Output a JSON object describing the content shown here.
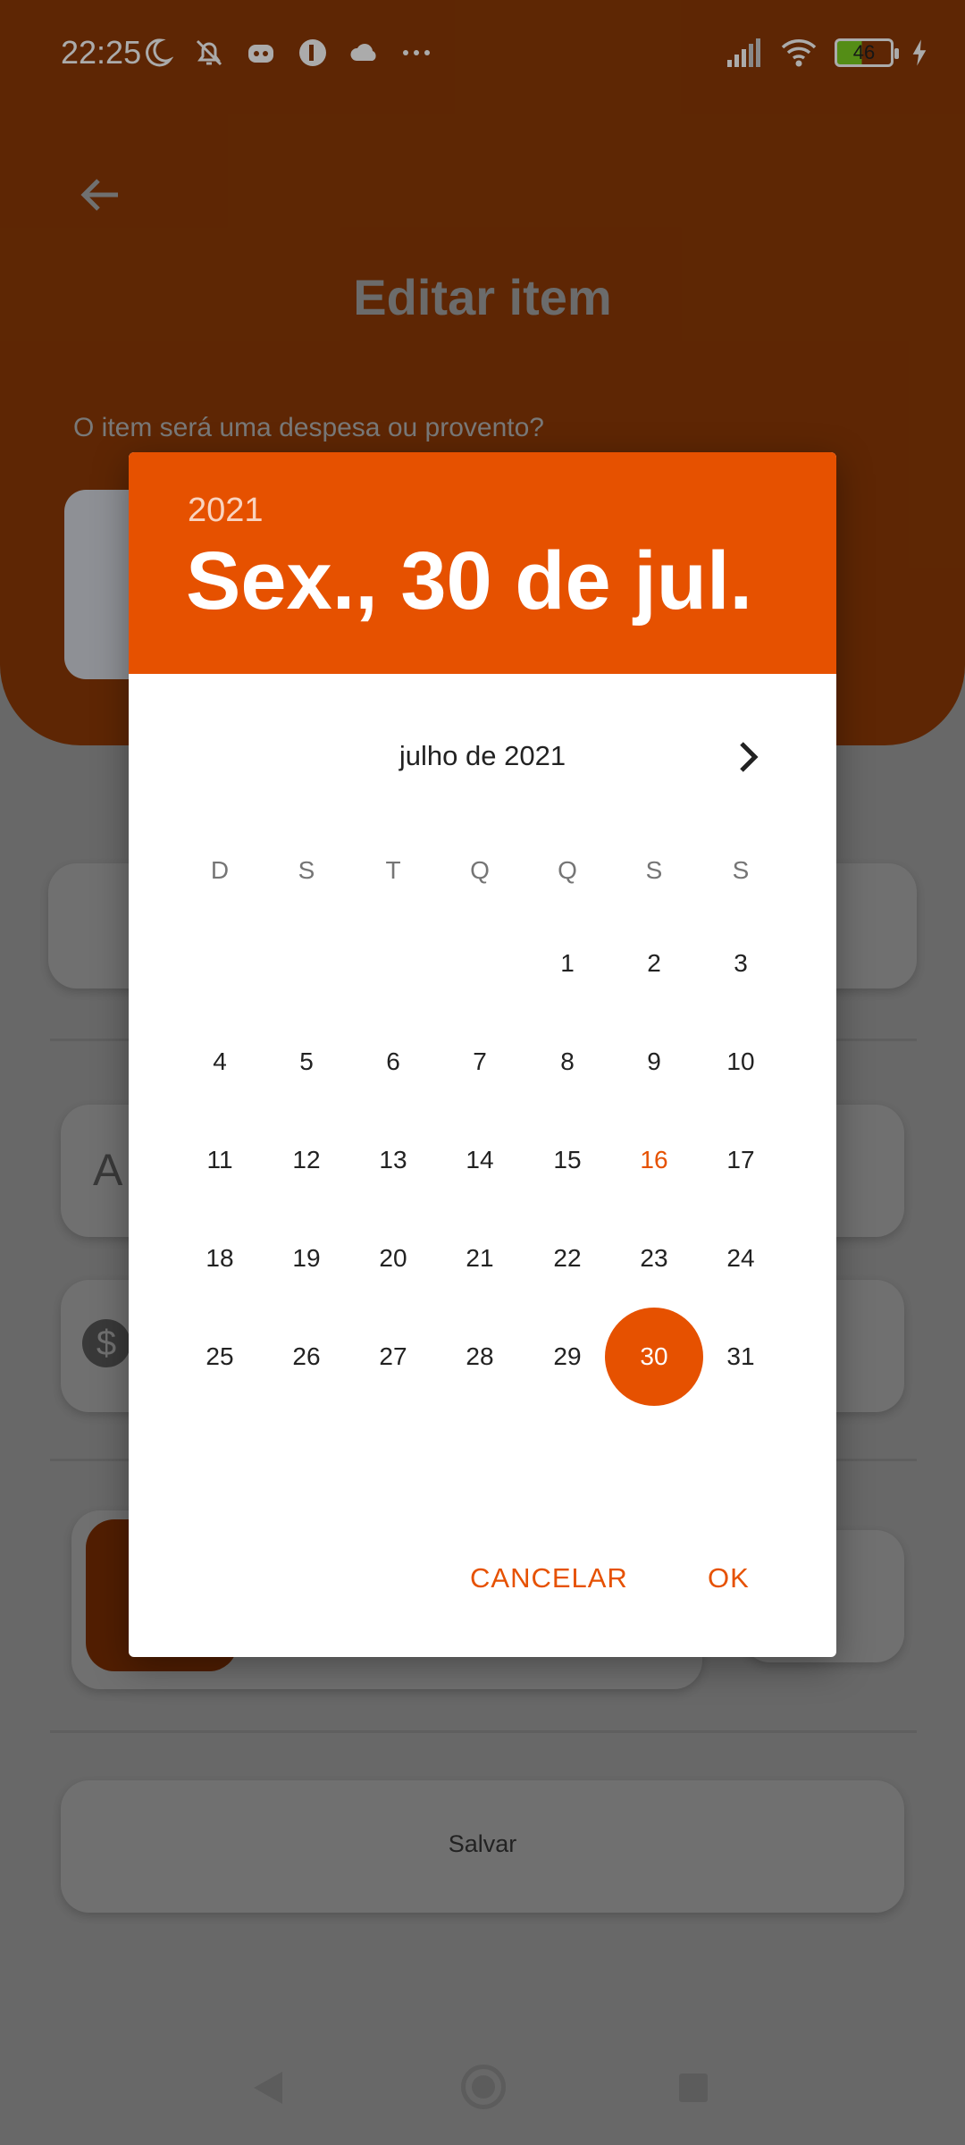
{
  "status_bar": {
    "time": "22:25",
    "battery": "46",
    "left_icons": [
      "moon-icon",
      "bell-off-icon",
      "discord-icon",
      "app-icon",
      "cloud-icon",
      "more-icon"
    ],
    "right_icons": [
      "signal-icon",
      "wifi-icon",
      "battery-icon",
      "charging-icon"
    ]
  },
  "background": {
    "title": "Editar item",
    "question": "O item será uma despesa ou provento?",
    "save_label": "Salvar"
  },
  "dialog": {
    "year": "2021",
    "selected_date": "Sex., 30 de jul.",
    "month_label": "julho de 2021",
    "weekdays": [
      "D",
      "S",
      "T",
      "Q",
      "Q",
      "S",
      "S"
    ],
    "first_weekday_index": 4,
    "days_in_month": 31,
    "today": 16,
    "selected": 30,
    "cancel_label": "CANCELAR",
    "ok_label": "OK"
  },
  "colors": {
    "accent": "#e65100",
    "header_dim": "#8c3a06"
  }
}
